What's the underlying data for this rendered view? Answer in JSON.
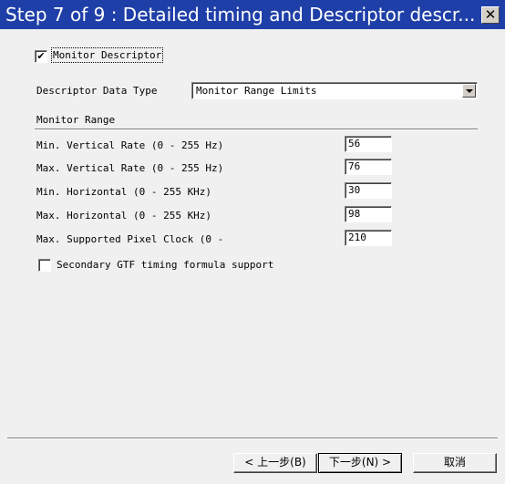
{
  "window": {
    "title": "Step 7 of 9 : Detailed timing and Descriptor descr...",
    "close_label": "✕"
  },
  "monitor_descriptor": {
    "label": "Monitor Descriptor",
    "checked": true,
    "check_glyph": "✔"
  },
  "descriptor_type": {
    "label": "Descriptor Data Type",
    "value": "Monitor Range Limits"
  },
  "range_group": {
    "label": "Monitor Range"
  },
  "fields": [
    {
      "label": "Min. Vertical Rate  (0 - 255 Hz)",
      "value": "56"
    },
    {
      "label": "Max. Vertical Rate  (0 - 255 Hz)",
      "value": "76"
    },
    {
      "label": "Min. Horizontal   (0 - 255 KHz)",
      "value": "30"
    },
    {
      "label": "Max. Horizontal  (0 - 255 KHz)",
      "value": "98"
    },
    {
      "label": "Max. Supported Pixel Clock  (0 -",
      "value": "210"
    }
  ],
  "secondary_gtf": {
    "label": "Secondary GTF timing formula support",
    "checked": false
  },
  "buttons": {
    "back": "< 上一步(B)",
    "next": "下一步(N) >",
    "cancel": "取消"
  }
}
